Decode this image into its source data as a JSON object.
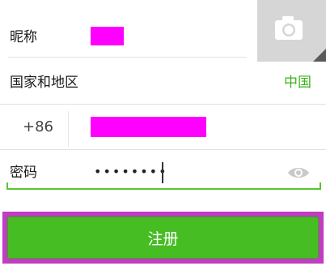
{
  "form": {
    "nickname_label": "昵称",
    "region_label": "国家和地区",
    "region_value": "中国",
    "country_code": "+86",
    "password_label": "密码",
    "password_masked": "••••••••"
  },
  "register_button": {
    "label": "注册"
  },
  "icons": {
    "avatar": "camera-icon",
    "password_visibility": "eye-icon"
  },
  "colors": {
    "accent_green": "#45bd23",
    "region_text": "#3fb21f",
    "redaction": "#ff00ff"
  }
}
